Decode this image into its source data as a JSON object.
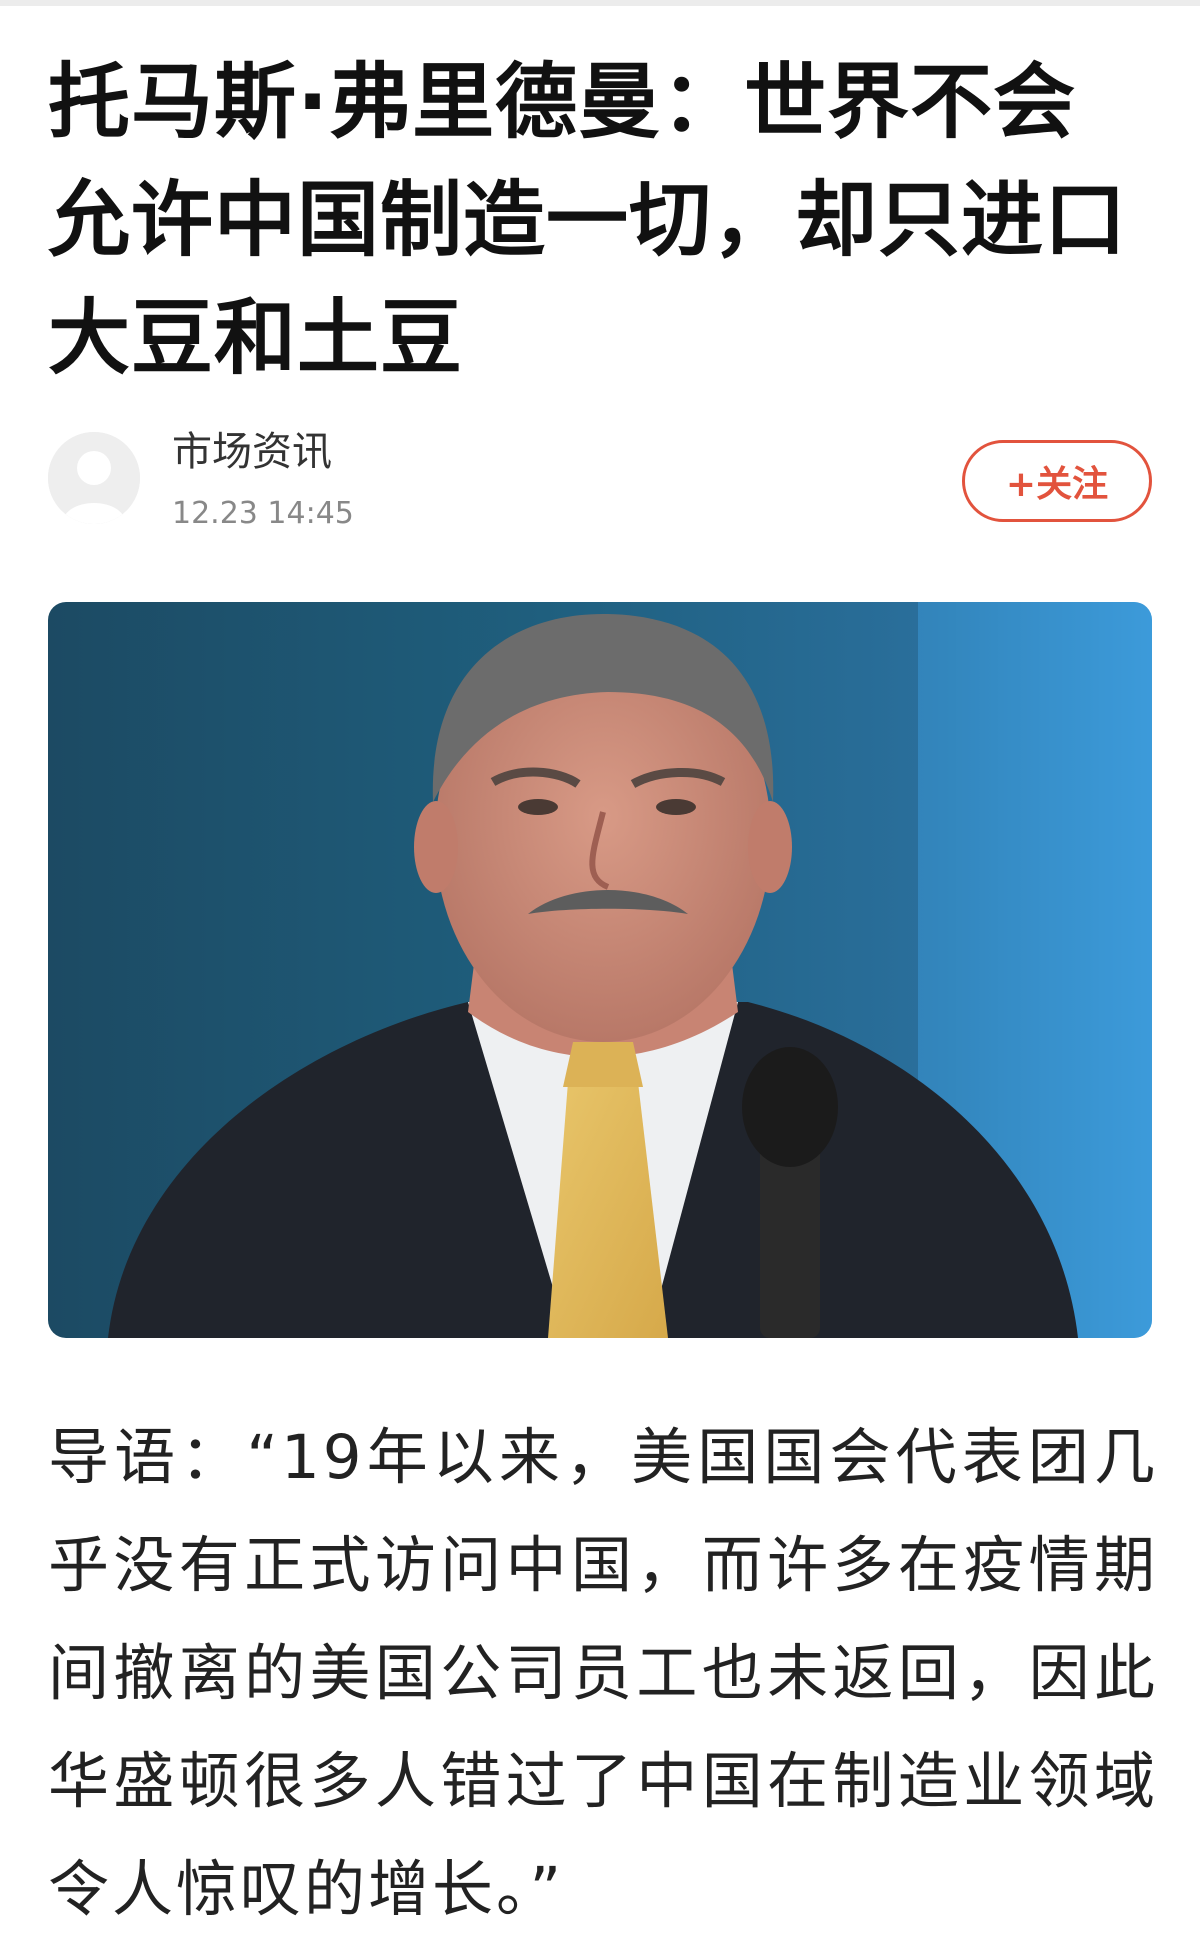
{
  "article": {
    "title": "托马斯·弗里德曼：世界不会允许中国制造一切，却只进口大豆和土豆",
    "intro": "导语：“19年以来，美国国会代表团几乎没有正式访问中国，而许多在疫情期间撤离的美国公司员工也未返回，因此华盛顿很多人错过了中国在制造业领域令人惊叹的增长。”"
  },
  "author": {
    "name": "市场资讯",
    "time": "12.23  14:45",
    "avatar_icon": "default-avatar-icon"
  },
  "follow_button": {
    "label": "+关注"
  },
  "colors": {
    "accent": "#e2533d",
    "title": "#111111",
    "meta": "#888888"
  }
}
